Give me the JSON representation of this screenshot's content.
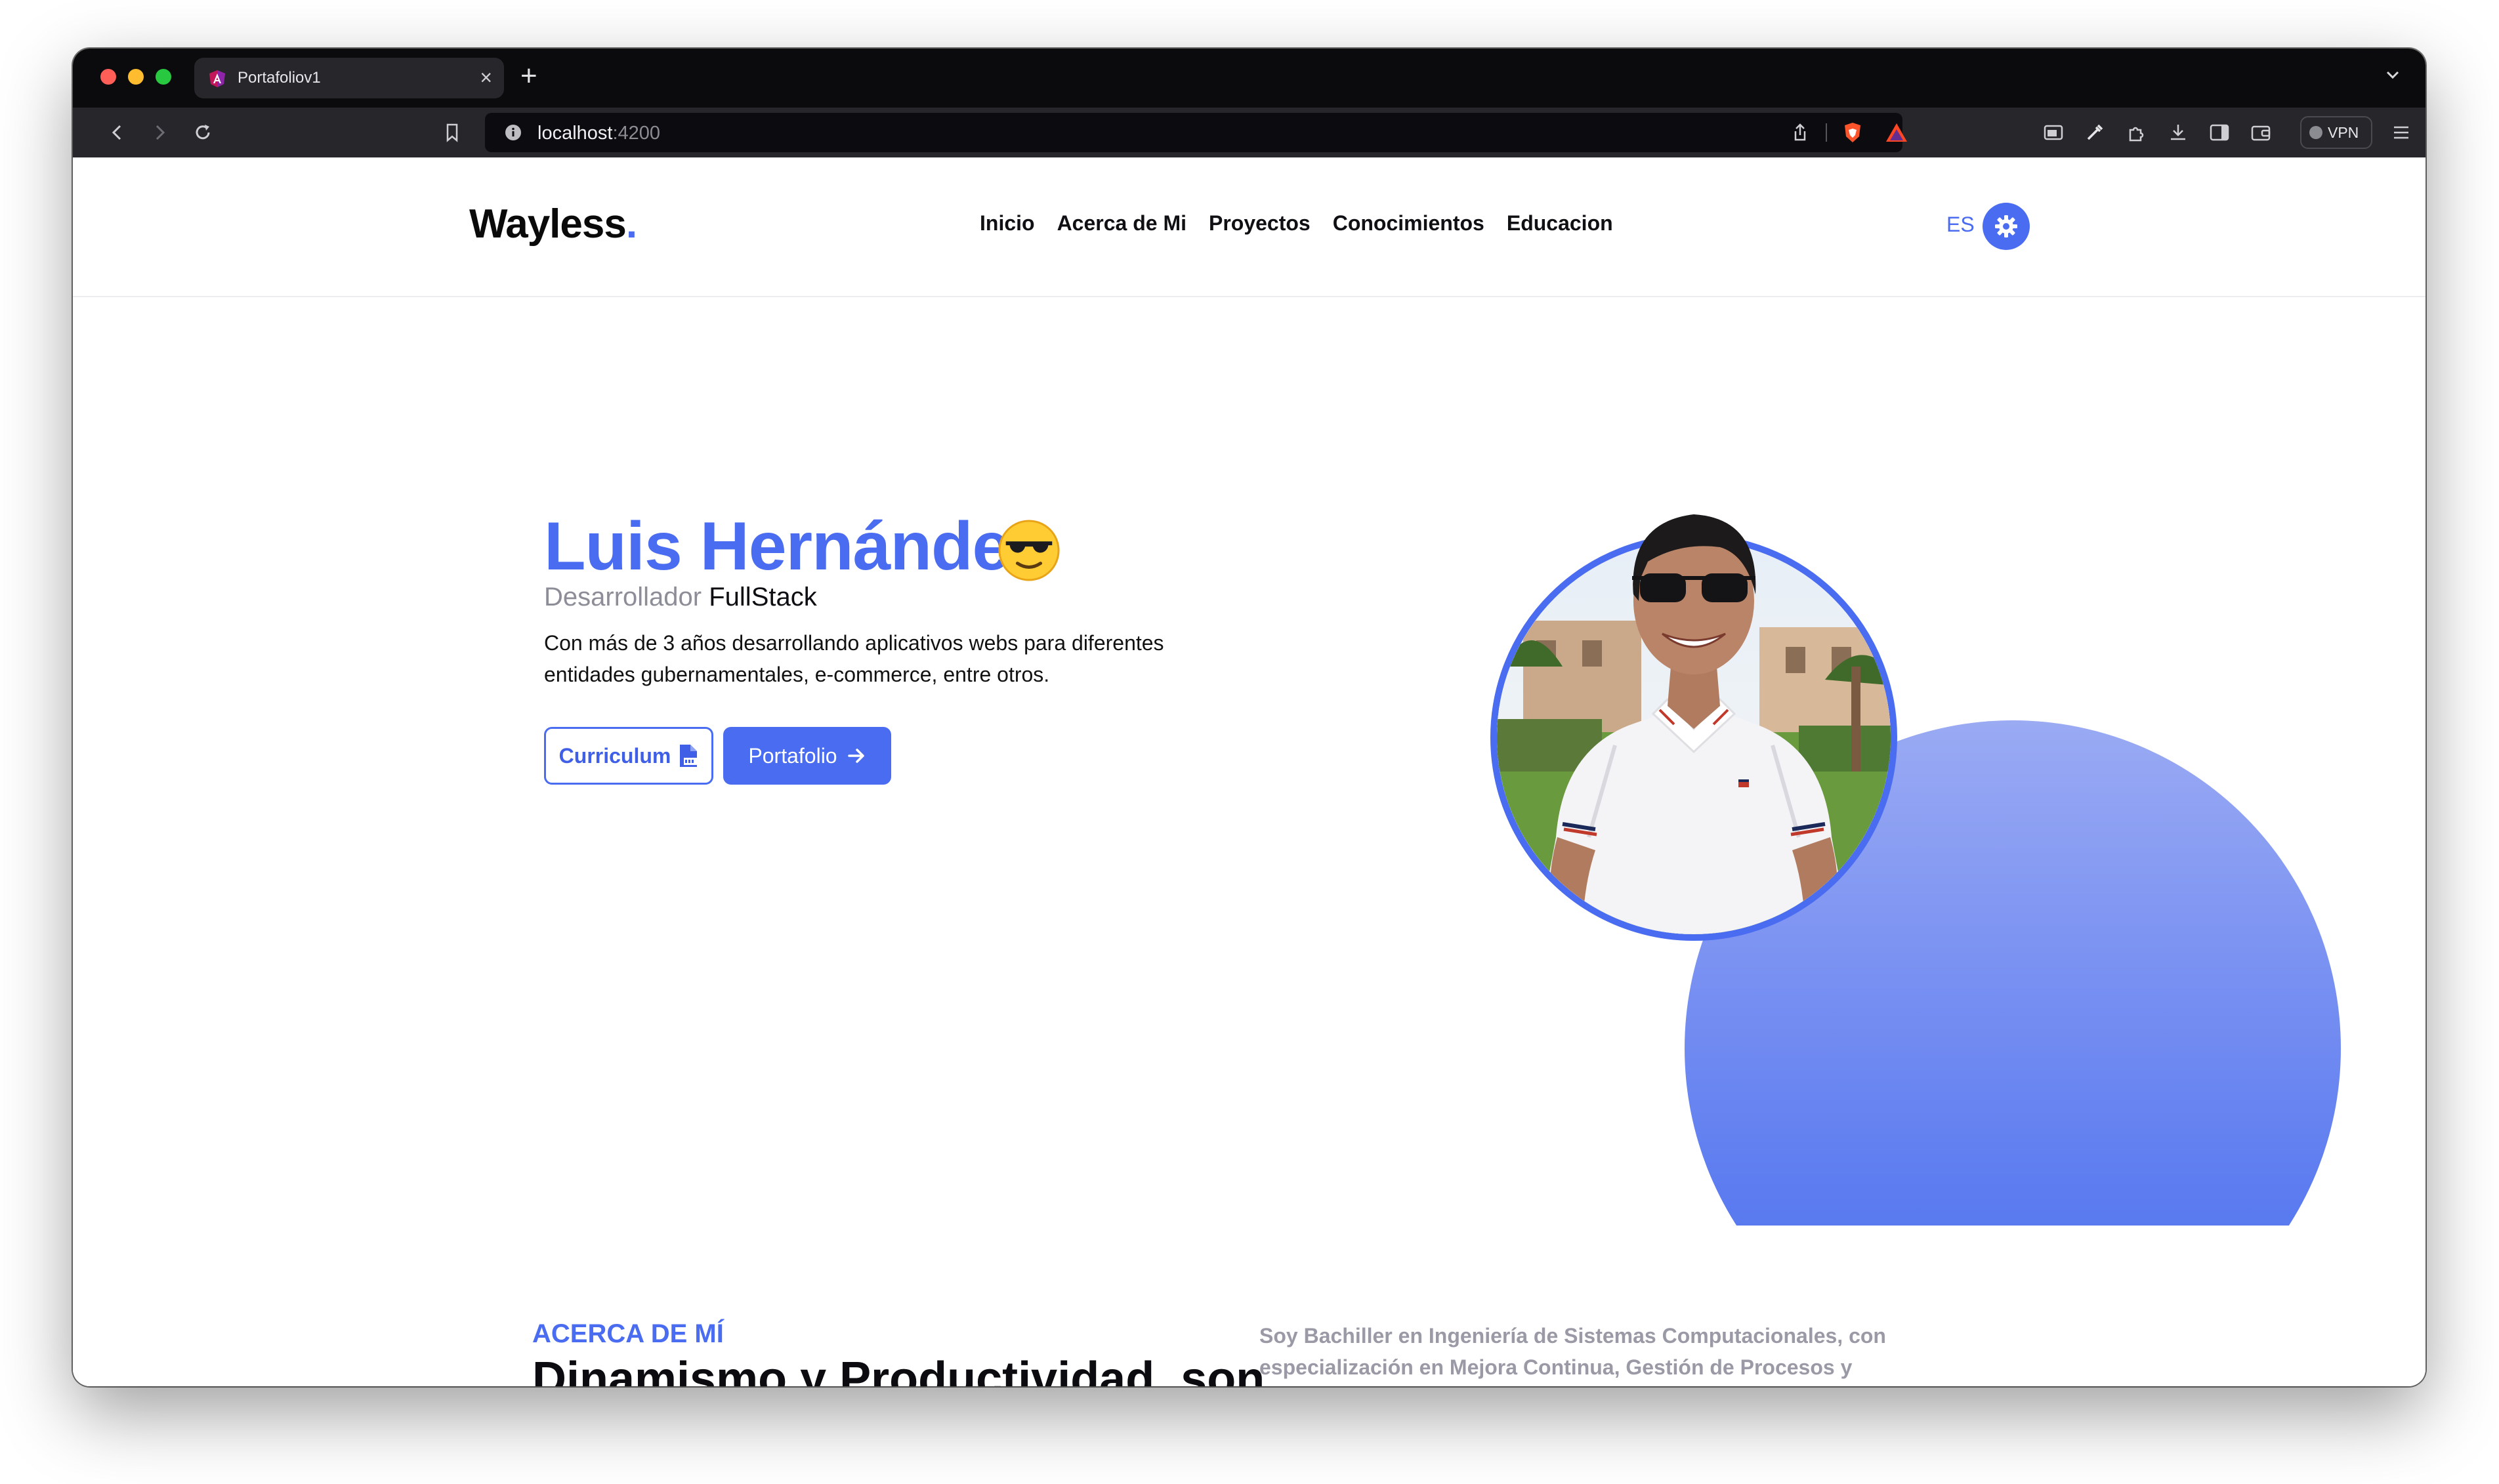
{
  "browser": {
    "tab_title": "Portafoliov1",
    "url_host": "localhost",
    "url_port": ":4200",
    "vpn_label": "VPN"
  },
  "site": {
    "logo": "Wayless",
    "logo_dot": ".",
    "nav": [
      "Inicio",
      "Acerca de Mi",
      "Proyectos",
      "Conocimientos",
      "Educacion"
    ],
    "lang": "ES"
  },
  "hero": {
    "name": "Luis Hernández",
    "role_prefix": "Desarrollador",
    "role_main": "FullStack",
    "description": "Con más de 3 años desarrollando aplicativos webs para diferentes entidades gubernamentales, e-commerce, entre otros.",
    "cv_button": "Curriculum",
    "portfolio_button": "Portafolio"
  },
  "about": {
    "kicker": "ACERCA DE MÍ",
    "title": "Dinamismo y Productividad, son lo que me representan",
    "text": "Soy Bachiller en Ingeniería de Sistemas Computacionales, con especialización en Mejora Continua, Gestión de Procesos y Calidad. Actualmente, me encuentro cursando la Maestría en Ingeniería de Sistemas con mención en Gerencia de Sistemas de la Información."
  },
  "colors": {
    "accent": "#4a6cf0",
    "muted_text": "#9a9aa6",
    "chrome_dark": "#0b0b0e",
    "chrome_toolbar": "#26262b"
  },
  "icons": {
    "toolbar": [
      "back-icon",
      "forward-icon",
      "reload-icon",
      "bookmark-icon",
      "site-info-icon",
      "share-icon",
      "brave-shield-icon",
      "brave-rewards-icon",
      "picture-in-picture-icon",
      "color-picker-icon",
      "extensions-icon",
      "download-icon",
      "sidebar-icon",
      "wallet-icon",
      "menu-icon"
    ],
    "hero": [
      "sunglasses-emoji-icon",
      "pdf-file-icon",
      "arrow-right-icon",
      "gear-icon"
    ]
  }
}
